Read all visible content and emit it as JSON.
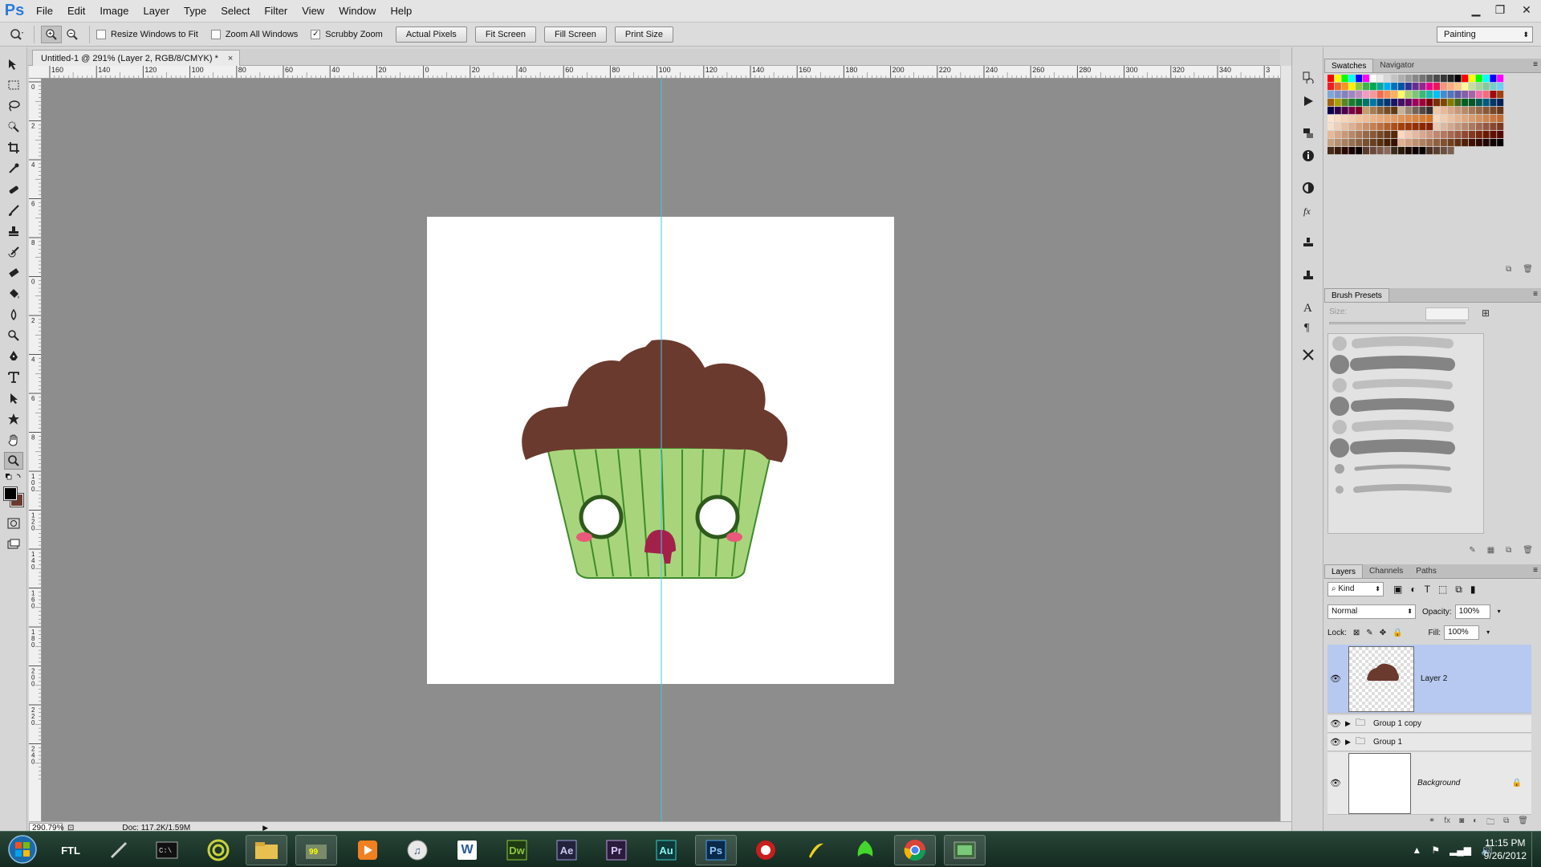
{
  "app": {
    "logo": "Ps"
  },
  "menu": [
    "File",
    "Edit",
    "Image",
    "Layer",
    "Type",
    "Select",
    "Filter",
    "View",
    "Window",
    "Help"
  ],
  "window_controls": {
    "minimize": "▁",
    "restore": "❐",
    "close": "✕"
  },
  "options_bar": {
    "resize_windows_label": "Resize Windows to Fit",
    "zoom_all_label": "Zoom All Windows",
    "scrubby_zoom_label": "Scrubby Zoom",
    "scrubby_zoom_checked": true,
    "buttons": [
      "Actual Pixels",
      "Fit Screen",
      "Fill Screen",
      "Print Size"
    ],
    "workspace": "Painting"
  },
  "document": {
    "tab_title": "Untitled-1 @ 291% (Layer 2, RGB/8/CMYK) *",
    "tab_close": "×",
    "zoom": "290.79%",
    "doc_info": "Doc: 117.2K/1.59M",
    "ruler_h_labels": [
      "160",
      "140",
      "120",
      "100",
      "80",
      "60",
      "40",
      "20",
      "0",
      "20",
      "40",
      "60",
      "80",
      "100",
      "120",
      "140",
      "160",
      "180",
      "200",
      "220",
      "240",
      "260",
      "280",
      "300",
      "320",
      "340",
      "3"
    ],
    "ruler_v_labels": [
      "0",
      "2",
      "4",
      "6",
      "8",
      "0",
      "2",
      "4",
      "6",
      "8",
      "1\n0\n0",
      "1\n2\n0",
      "1\n4\n0",
      "1\n6\n0",
      "1\n8\n0",
      "2\n0\n0",
      "2\n2\n0",
      "2\n4\n0"
    ],
    "canvas_bg": "#8d8d8d",
    "frosting_color": "#6b3a2e",
    "liner_color": "#a8d57c",
    "liner_stroke": "#3f8a2c",
    "guide_color": "#40c8e8",
    "cheek_color": "#e8597a",
    "mouth_color": "#a3204a"
  },
  "panels": {
    "swatches_tabs": [
      "Swatches",
      "Navigator"
    ],
    "brush_tab": "Brush Presets",
    "brush_size_label": "Size:",
    "layers_tabs": [
      "Layers",
      "Channels",
      "Paths"
    ],
    "kind_label": "Kind",
    "blend_mode": "Normal",
    "opacity_label": "Opacity:",
    "opacity_value": "100%",
    "lock_label": "Lock:",
    "fill_label": "Fill:",
    "fill_value": "100%",
    "layers": [
      {
        "name": "Layer 2",
        "selected": true
      },
      {
        "name": "Group 1 copy",
        "selected": false
      },
      {
        "name": "Group 1",
        "selected": false
      },
      {
        "name": "Background",
        "selected": false
      }
    ]
  },
  "taskbar": {
    "time": "11:15 PM",
    "date": "9/26/2012",
    "apps": [
      "ftl-icon",
      "pen-icon",
      "terminal-icon",
      "radar-icon",
      "folder-icon",
      "game-icon",
      "media-player-icon",
      "itunes-icon",
      "word-icon",
      "dreamweaver-icon",
      "after-effects-icon",
      "premiere-icon",
      "audition-icon",
      "photoshop-icon",
      "sop-icon",
      "banana-icon",
      "razer-icon",
      "chrome-icon",
      "green-app-icon"
    ],
    "labels": {
      "word": "W",
      "dreamweaver": "Dw",
      "after_effects": "Ae",
      "premiere": "Pr",
      "audition": "Au",
      "photoshop": "Ps",
      "ftl": "FTL"
    }
  }
}
